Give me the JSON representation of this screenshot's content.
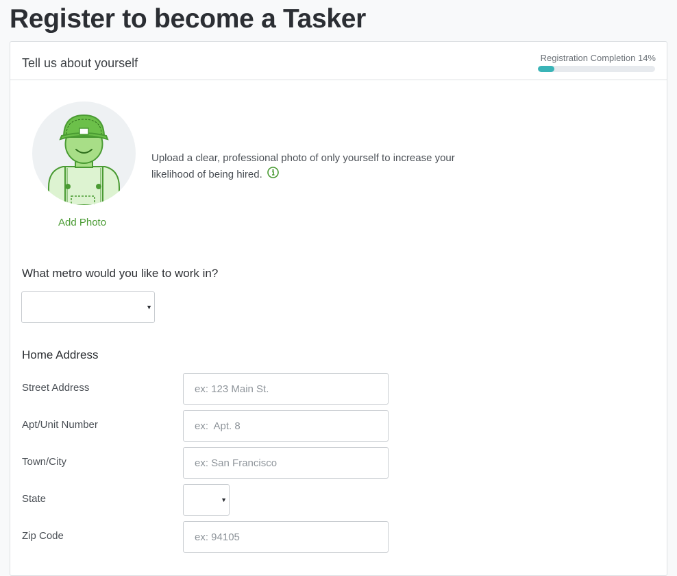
{
  "page": {
    "title": "Register to become a Tasker"
  },
  "header": {
    "section_title": "Tell us about yourself",
    "progress_label": "Registration Completion 14%",
    "progress_fraction": 0.14,
    "accent_color": "#3ab4b7"
  },
  "photo": {
    "add_label": "Add Photo",
    "upload_text": "Upload a clear, professional photo of only yourself to increase your likelihood of being hired.",
    "avatar_icon": "tasker-avatar-icon",
    "info_icon": "info-icon",
    "brand_color": "#4a9b33"
  },
  "metro": {
    "question": "What metro would you like to work in?",
    "selected": ""
  },
  "address": {
    "title": "Home Address",
    "street": {
      "label": "Street Address",
      "placeholder": "ex: 123 Main St.",
      "value": ""
    },
    "apt": {
      "label": "Apt/Unit Number",
      "placeholder": "ex:  Apt. 8",
      "value": ""
    },
    "city": {
      "label": "Town/City",
      "placeholder": "ex: San Francisco",
      "value": ""
    },
    "state": {
      "label": "State",
      "selected": ""
    },
    "zip": {
      "label": "Zip Code",
      "placeholder": "ex: 94105",
      "value": ""
    }
  }
}
